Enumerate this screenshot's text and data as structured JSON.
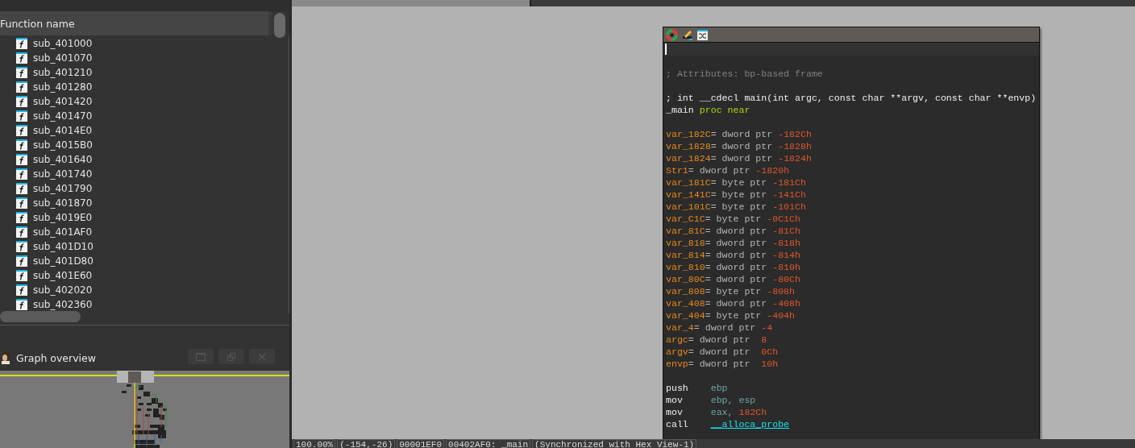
{
  "functions": {
    "column": "Function name",
    "items": [
      {
        "name": "sub_401000"
      },
      {
        "name": "sub_401070"
      },
      {
        "name": "sub_401210"
      },
      {
        "name": "sub_401280"
      },
      {
        "name": "sub_401420"
      },
      {
        "name": "sub_401470"
      },
      {
        "name": "sub_4014E0"
      },
      {
        "name": "sub_4015B0"
      },
      {
        "name": "sub_401640"
      },
      {
        "name": "sub_401740"
      },
      {
        "name": "sub_401790"
      },
      {
        "name": "sub_401870"
      },
      {
        "name": "sub_4019E0"
      },
      {
        "name": "sub_401AF0"
      },
      {
        "name": "sub_401D10"
      },
      {
        "name": "sub_401D80"
      },
      {
        "name": "sub_401E60"
      },
      {
        "name": "sub_402020"
      },
      {
        "name": "sub_402360"
      }
    ]
  },
  "graph_overview": {
    "title": "Graph overview"
  },
  "disassembly": {
    "lines": [
      {
        "kind": "cursor"
      },
      {
        "kind": "blank"
      },
      {
        "kind": "code",
        "segments": [
          {
            "kind": "comment",
            "text": "; Attributes: bp-based frame"
          }
        ]
      },
      {
        "kind": "blank"
      },
      {
        "kind": "code",
        "segments": [
          {
            "kind": "keyword",
            "text": "; int __cdecl main(int argc, const char **argv, const char **envp)"
          }
        ]
      },
      {
        "kind": "code",
        "segments": [
          {
            "kind": "keyword",
            "text": "_main"
          },
          {
            "kind": "directive",
            "text": " proc near"
          }
        ]
      },
      {
        "kind": "blank"
      },
      {
        "kind": "code",
        "segments": [
          {
            "kind": "label",
            "text": "var_182C"
          },
          {
            "kind": "plain",
            "text": "= dword ptr "
          },
          {
            "kind": "number",
            "text": "-182Ch"
          }
        ]
      },
      {
        "kind": "code",
        "segments": [
          {
            "kind": "label",
            "text": "var_1828"
          },
          {
            "kind": "plain",
            "text": "= dword ptr "
          },
          {
            "kind": "number",
            "text": "-1828h"
          }
        ]
      },
      {
        "kind": "code",
        "segments": [
          {
            "kind": "label",
            "text": "var_1824"
          },
          {
            "kind": "plain",
            "text": "= dword ptr "
          },
          {
            "kind": "number",
            "text": "-1824h"
          }
        ]
      },
      {
        "kind": "code",
        "segments": [
          {
            "kind": "label",
            "text": "Str1"
          },
          {
            "kind": "plain",
            "text": "= dword ptr "
          },
          {
            "kind": "number",
            "text": "-1820h"
          }
        ]
      },
      {
        "kind": "code",
        "segments": [
          {
            "kind": "label",
            "text": "var_181C"
          },
          {
            "kind": "plain",
            "text": "= byte ptr "
          },
          {
            "kind": "number",
            "text": "-181Ch"
          }
        ]
      },
      {
        "kind": "code",
        "segments": [
          {
            "kind": "label",
            "text": "var_141C"
          },
          {
            "kind": "plain",
            "text": "= byte ptr "
          },
          {
            "kind": "number",
            "text": "-141Ch"
          }
        ]
      },
      {
        "kind": "code",
        "segments": [
          {
            "kind": "label",
            "text": "var_101C"
          },
          {
            "kind": "plain",
            "text": "= byte ptr "
          },
          {
            "kind": "number",
            "text": "-101Ch"
          }
        ]
      },
      {
        "kind": "code",
        "segments": [
          {
            "kind": "label",
            "text": "var_C1C"
          },
          {
            "kind": "plain",
            "text": "= byte ptr "
          },
          {
            "kind": "number",
            "text": "-0C1Ch"
          }
        ]
      },
      {
        "kind": "code",
        "segments": [
          {
            "kind": "label",
            "text": "var_81C"
          },
          {
            "kind": "plain",
            "text": "= dword ptr "
          },
          {
            "kind": "number",
            "text": "-81Ch"
          }
        ]
      },
      {
        "kind": "code",
        "segments": [
          {
            "kind": "label",
            "text": "var_818"
          },
          {
            "kind": "plain",
            "text": "= dword ptr "
          },
          {
            "kind": "number",
            "text": "-818h"
          }
        ]
      },
      {
        "kind": "code",
        "segments": [
          {
            "kind": "label",
            "text": "var_814"
          },
          {
            "kind": "plain",
            "text": "= dword ptr "
          },
          {
            "kind": "number",
            "text": "-814h"
          }
        ]
      },
      {
        "kind": "code",
        "segments": [
          {
            "kind": "label",
            "text": "var_810"
          },
          {
            "kind": "plain",
            "text": "= dword ptr "
          },
          {
            "kind": "number",
            "text": "-810h"
          }
        ]
      },
      {
        "kind": "code",
        "segments": [
          {
            "kind": "label",
            "text": "var_80C"
          },
          {
            "kind": "plain",
            "text": "= dword ptr "
          },
          {
            "kind": "number",
            "text": "-80Ch"
          }
        ]
      },
      {
        "kind": "code",
        "segments": [
          {
            "kind": "label",
            "text": "var_808"
          },
          {
            "kind": "plain",
            "text": "= byte ptr "
          },
          {
            "kind": "number",
            "text": "-808h"
          }
        ]
      },
      {
        "kind": "code",
        "segments": [
          {
            "kind": "label",
            "text": "var_408"
          },
          {
            "kind": "plain",
            "text": "= dword ptr "
          },
          {
            "kind": "number",
            "text": "-408h"
          }
        ]
      },
      {
        "kind": "code",
        "segments": [
          {
            "kind": "label",
            "text": "var_404"
          },
          {
            "kind": "plain",
            "text": "= byte ptr "
          },
          {
            "kind": "number",
            "text": "-404h"
          }
        ]
      },
      {
        "kind": "code",
        "segments": [
          {
            "kind": "label",
            "text": "var_4"
          },
          {
            "kind": "plain",
            "text": "= dword ptr "
          },
          {
            "kind": "number",
            "text": "-4"
          }
        ]
      },
      {
        "kind": "code",
        "segments": [
          {
            "kind": "label",
            "text": "argc"
          },
          {
            "kind": "plain",
            "text": "= dword ptr  "
          },
          {
            "kind": "number",
            "text": "8"
          }
        ]
      },
      {
        "kind": "code",
        "segments": [
          {
            "kind": "label",
            "text": "argv"
          },
          {
            "kind": "plain",
            "text": "= dword ptr  "
          },
          {
            "kind": "number",
            "text": "0Ch"
          }
        ]
      },
      {
        "kind": "code",
        "segments": [
          {
            "kind": "label",
            "text": "envp"
          },
          {
            "kind": "plain",
            "text": "= dword ptr  "
          },
          {
            "kind": "number",
            "text": "10h"
          }
        ]
      },
      {
        "kind": "blank"
      },
      {
        "kind": "code",
        "segments": [
          {
            "kind": "keyword",
            "text": "push    "
          },
          {
            "kind": "register",
            "text": "ebp"
          }
        ]
      },
      {
        "kind": "code",
        "segments": [
          {
            "kind": "keyword",
            "text": "mov     "
          },
          {
            "kind": "register",
            "text": "ebp, esp"
          }
        ]
      },
      {
        "kind": "code",
        "segments": [
          {
            "kind": "keyword",
            "text": "mov     "
          },
          {
            "kind": "register",
            "text": "eax, "
          },
          {
            "kind": "number",
            "text": "182Ch"
          }
        ]
      },
      {
        "kind": "code",
        "segments": [
          {
            "kind": "keyword",
            "text": "call    "
          },
          {
            "kind": "name",
            "text": "__alloca_probe"
          }
        ]
      }
    ]
  },
  "status_bar": [
    "100.00%",
    "(-154,-26)",
    "00001EF0",
    "00402AF0: _main",
    "(Synchronized with Hex View-1)"
  ]
}
